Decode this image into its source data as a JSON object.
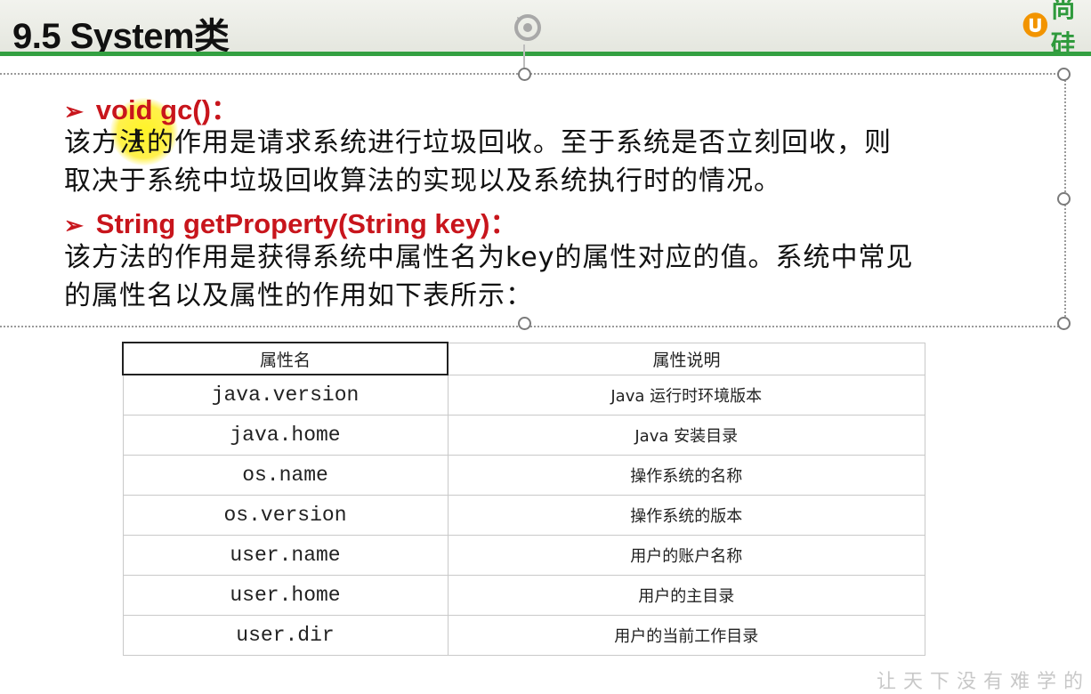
{
  "header": {
    "title": "9.5 System类",
    "logo_text": "尚硅"
  },
  "content": {
    "gc": {
      "signature": "void gc()：",
      "lines": [
        "该方法的作用是请求系统进行垃圾回收。至于系统是否立刻回收，则",
        "取决于系统中垃圾回收算法的实现以及系统执行时的情况。"
      ]
    },
    "getProperty": {
      "signature": "String getProperty(String key)：",
      "lines": [
        "该方法的作用是获得系统中属性名为key的属性对应的值。系统中常见",
        "的属性名以及属性的作用如下表所示："
      ]
    }
  },
  "table": {
    "headers": [
      "属性名",
      "属性说明"
    ],
    "rows": [
      {
        "key": "java.version",
        "desc": "Java 运行时环境版本"
      },
      {
        "key": "java.home",
        "desc": "Java 安装目录"
      },
      {
        "key": "os.name",
        "desc": "操作系统的名称"
      },
      {
        "key": "os.version",
        "desc": "操作系统的版本"
      },
      {
        "key": "user.name",
        "desc": "用户的账户名称"
      },
      {
        "key": "user.home",
        "desc": "用户的主目录"
      },
      {
        "key": "user.dir",
        "desc": "用户的当前工作目录"
      }
    ]
  },
  "footer": {
    "watermark": "让天下没有难学的"
  },
  "colors": {
    "accent_green": "#33a041",
    "signature_red": "#c8151c"
  }
}
